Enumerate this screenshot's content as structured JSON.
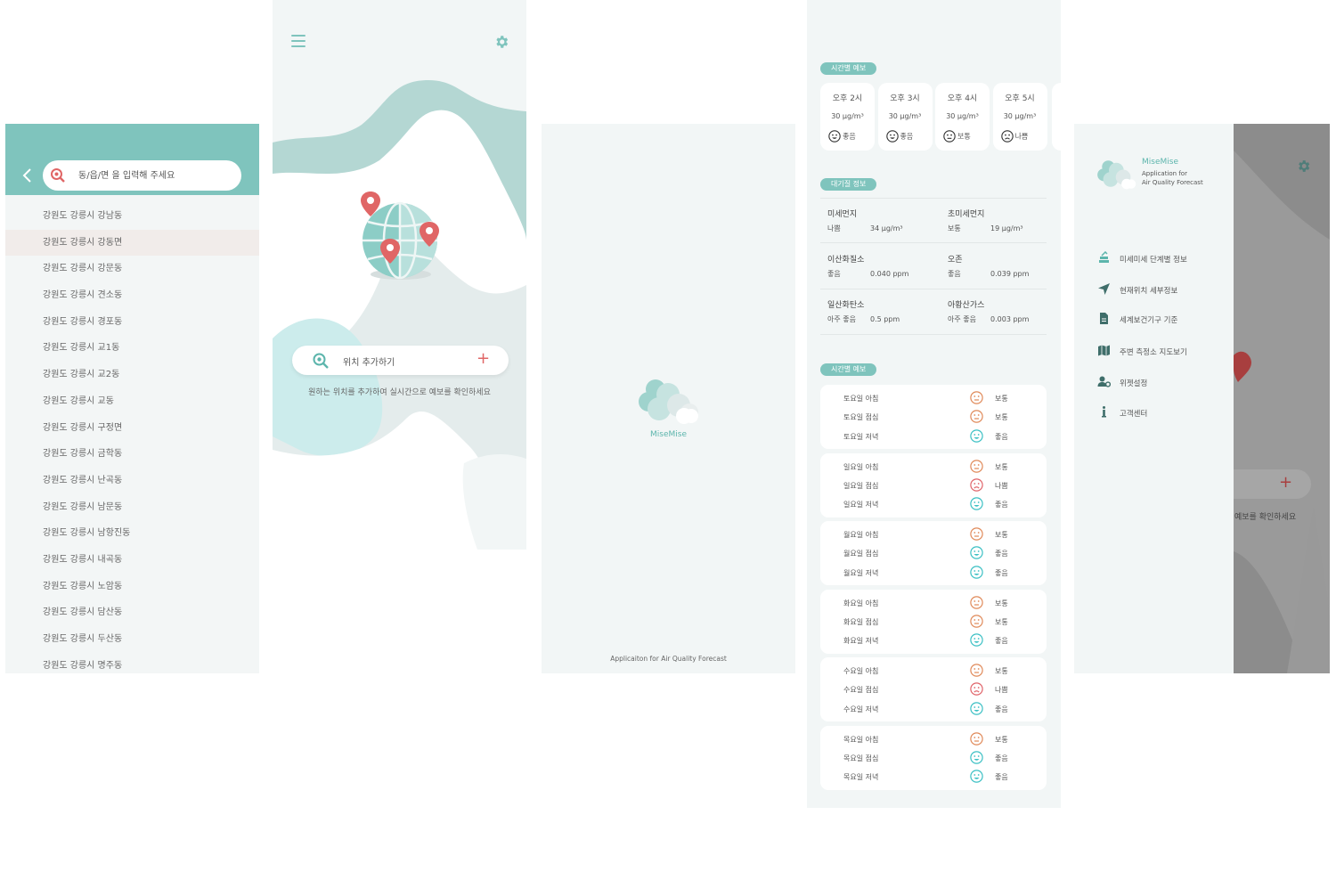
{
  "search_screen": {
    "search": {
      "placeholder": "동/읍/면 을 입력해 주세요"
    },
    "items": [
      "강원도 강릉시 강남동",
      "강원도 강릉시 강동면",
      "강원도 강릉시 강문동",
      "강원도 강릉시 견소동",
      "강원도 강릉시 경포동",
      "강원도 강릉시 교1동",
      "강원도 강릉시 교2동",
      "강원도 강릉시 교동",
      "강원도 강릉시 구정면",
      "강원도 강릉시 금학동",
      "강원도 강릉시 난곡동",
      "강원도 강릉시 남문동",
      "강원도 강릉시 남항진동",
      "강원도 강릉시 내곡동",
      "강원도 강릉시 노암동",
      "강원도 강릉시 담산동",
      "강원도 강릉시 두산동",
      "강원도 강릉시 명주동"
    ],
    "highlighted_index": 1
  },
  "main_screen": {
    "add_location_label": "위치 추가하기",
    "add_icon": "+",
    "hint": "원하는 위치를 추가하여 실시간으로 예보를 확인하세요"
  },
  "splash_screen": {
    "app_name": "MiseMise",
    "footer": "Applicaiton for Air Quality Forecast"
  },
  "detail_screen": {
    "hourly_label": "시간별 예보",
    "hourly": [
      {
        "time": "오후 2시",
        "value": "30 μg/m³",
        "status": "좋음",
        "face": "good"
      },
      {
        "time": "오후 3시",
        "value": "30 μg/m³",
        "status": "좋음",
        "face": "good"
      },
      {
        "time": "오후 4시",
        "value": "30 μg/m³",
        "status": "보통",
        "face": "normal"
      },
      {
        "time": "오후 5시",
        "value": "30 μg/m³",
        "status": "나쁨",
        "face": "bad"
      }
    ],
    "air_label": "대기질 정보",
    "air": [
      [
        {
          "name": "미세먼지",
          "grade": "나쁨",
          "value": "34 μg/m³"
        },
        {
          "name": "초미세먼지",
          "grade": "보통",
          "value": "19 μg/m³"
        }
      ],
      [
        {
          "name": "이산화질소",
          "grade": "좋음",
          "value": "0.040 ppm"
        },
        {
          "name": "오존",
          "grade": "좋음",
          "value": "0.039 ppm"
        }
      ],
      [
        {
          "name": "일산화탄소",
          "grade": "아주 좋음",
          "value": "0.5 ppm"
        },
        {
          "name": "아황산가스",
          "grade": "아주 좋음",
          "value": "0.003 ppm"
        }
      ]
    ],
    "daily_label": "시간별 예보",
    "daily": [
      [
        {
          "label": "토요일 아침",
          "status": "보통"
        },
        {
          "label": "토요일 점심",
          "status": "보통"
        },
        {
          "label": "토요일 저녁",
          "status": "좋음"
        }
      ],
      [
        {
          "label": "일요일 아침",
          "status": "보통"
        },
        {
          "label": "일요일 점심",
          "status": "나쁨"
        },
        {
          "label": "일요일 저녁",
          "status": "좋음"
        }
      ],
      [
        {
          "label": "월요일 아침",
          "status": "보통"
        },
        {
          "label": "월요일 점심",
          "status": "좋음"
        },
        {
          "label": "월요일 저녁",
          "status": "좋음"
        }
      ],
      [
        {
          "label": "화요일 아침",
          "status": "보통"
        },
        {
          "label": "화요일 점심",
          "status": "보통"
        },
        {
          "label": "화요일 저녁",
          "status": "좋음"
        }
      ],
      [
        {
          "label": "수요일 아침",
          "status": "보통"
        },
        {
          "label": "수요일 점심",
          "status": "나쁨"
        },
        {
          "label": "수요일 저녁",
          "status": "좋음"
        }
      ],
      [
        {
          "label": "목요일 아침",
          "status": "보통"
        },
        {
          "label": "목요일 점심",
          "status": "좋음"
        },
        {
          "label": "목요일 저녁",
          "status": "좋음"
        }
      ]
    ]
  },
  "drawer_screen": {
    "app_name": "MiseMise",
    "app_sub_1": "Application for",
    "app_sub_2": "Air Quality Forecast",
    "menu": [
      {
        "label": "미세미세 단계별 정보",
        "icon": "stack-icon"
      },
      {
        "label": "현재위치 세부정보",
        "icon": "navigation-icon"
      },
      {
        "label": "세계보건기구 기준",
        "icon": "document-icon"
      },
      {
        "label": "주변 측정소 지도보기",
        "icon": "map-icon"
      },
      {
        "label": "위젯설정",
        "icon": "user-settings-icon"
      },
      {
        "label": "고객센터",
        "icon": "info-icon"
      }
    ],
    "add_icon": "+",
    "hint_fragment": "예보를 확인하세요"
  },
  "colors": {
    "teal": "#7fc4bd",
    "teal_dark": "#5cb5ac",
    "red_pin": "#e06666",
    "good": "#3cc0c4",
    "normal": "#e08a5a",
    "bad": "#e0646a"
  }
}
